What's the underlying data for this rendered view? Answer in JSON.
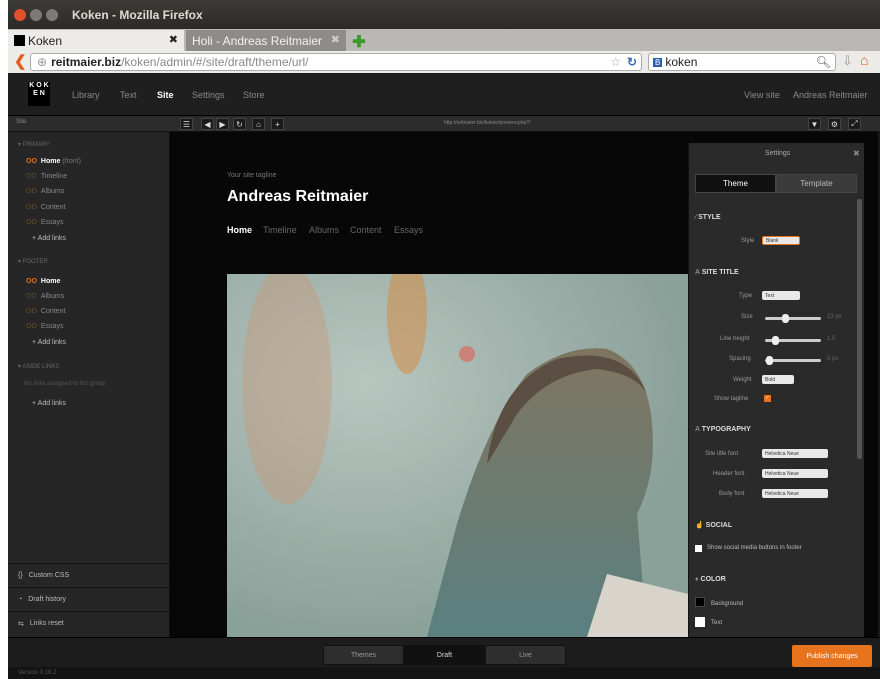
{
  "window": {
    "title": "Koken - Mozilla Firefox"
  },
  "tabs": [
    {
      "label": "Koken"
    },
    {
      "label": "Holi - Andreas Reitmaier"
    }
  ],
  "nav": {
    "url_domain": "reitmaier.biz",
    "url_path": "/koken/admin/#/site/draft/theme/url/",
    "search_engine": "koken"
  },
  "header": {
    "logo": "K O K E N",
    "items": [
      "Library",
      "Text",
      "Site",
      "Settings",
      "Store"
    ],
    "active": "Site",
    "view_site": "View site",
    "user": "Andreas Reitmaier"
  },
  "subbar": {
    "label": "Site",
    "preview_url": "http://reitmaier.biz/koken/preview.php?/"
  },
  "sidebar": {
    "primary": {
      "title": "Primary",
      "items": [
        {
          "label": "Home",
          "suffix": "(front)"
        },
        {
          "label": "Timeline"
        },
        {
          "label": "Albums"
        },
        {
          "label": "Content"
        },
        {
          "label": "Essays"
        }
      ],
      "add": "Add links"
    },
    "footer": {
      "title": "Footer",
      "items": [
        {
          "label": "Home"
        },
        {
          "label": "Albums"
        },
        {
          "label": "Content"
        },
        {
          "label": "Essays"
        }
      ],
      "add": "Add links"
    },
    "aside": {
      "title": "Aside links",
      "empty": "No links assigned to this group",
      "add": "Add links"
    },
    "bottom": [
      "Custom CSS",
      "Draft history",
      "Links reset"
    ]
  },
  "site": {
    "tagline": "Your site tagline",
    "title": "Andreas Reitmaier",
    "menu": [
      "Home",
      "Timeline",
      "Albums",
      "Content",
      "Essays"
    ]
  },
  "settings": {
    "title": "Settings",
    "tabs": [
      "Theme",
      "Template"
    ],
    "style": {
      "head": "Style",
      "label": "Style",
      "value": "Blank"
    },
    "site_title": {
      "head": "Site title",
      "type_label": "Type",
      "type_value": "Text",
      "size_label": "Size",
      "size_value": "23 px",
      "size_pct": 0.35,
      "lh_label": "Line height",
      "lh_value": "1.5",
      "lh_pct": 0.15,
      "spacing_label": "Spacing",
      "spacing_value": "0 px",
      "spacing_pct": 0.02,
      "weight_label": "Weight",
      "weight_value": "Bold",
      "tagline_label": "Show tagline"
    },
    "typography": {
      "head": "Typography",
      "fields": [
        {
          "label": "Site title font",
          "value": "Helvetica Neue"
        },
        {
          "label": "Header font",
          "value": "Helvetica Neue"
        },
        {
          "label": "Body font",
          "value": "Helvetica Neue"
        }
      ]
    },
    "social": {
      "head": "Social",
      "checkbox": "Show social media buttons in footer"
    },
    "color": {
      "head": "Color",
      "items": [
        "Background",
        "Text"
      ]
    }
  },
  "bottom": {
    "tabs": [
      "Themes",
      "Draft",
      "Live"
    ],
    "active": "Draft",
    "publish": "Publish changes",
    "version": "Version 0.16.2"
  },
  "colors": {
    "accent": "#e8731e"
  }
}
